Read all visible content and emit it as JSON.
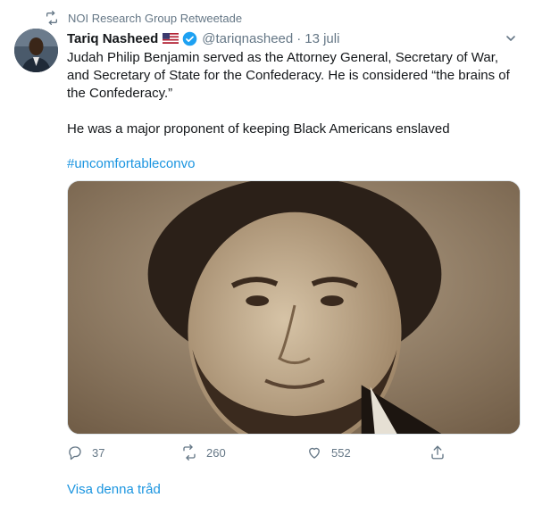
{
  "retweet_context": {
    "icon": "retweet-icon",
    "text": "NOI Research Group Retweetade"
  },
  "tweet": {
    "author_name": "Tariq Nasheed",
    "flag_icon": "us-flag-icon",
    "verified_icon": "verified-badge-icon",
    "handle": "@tariqnasheed",
    "separator": "·",
    "date": "13 juli",
    "paragraph1": "Judah Philip Benjamin served as the Attorney General, Secretary of War, and Secretary of State for the Confederacy. He is considered “the brains of the Confederacy.”",
    "paragraph2": "He was a major proponent of keeping Black Americans enslaved",
    "hashtag": "#uncomfortableconvo",
    "photo_icon": "portrait-photo",
    "actions": {
      "reply_count": "37",
      "retweet_count": "260",
      "like_count": "552"
    }
  },
  "show_thread": "Visa denna tråd",
  "colors": {
    "link": "#1b95e0",
    "muted": "#657786",
    "text": "#14171a",
    "verified": "#1da1f2"
  }
}
